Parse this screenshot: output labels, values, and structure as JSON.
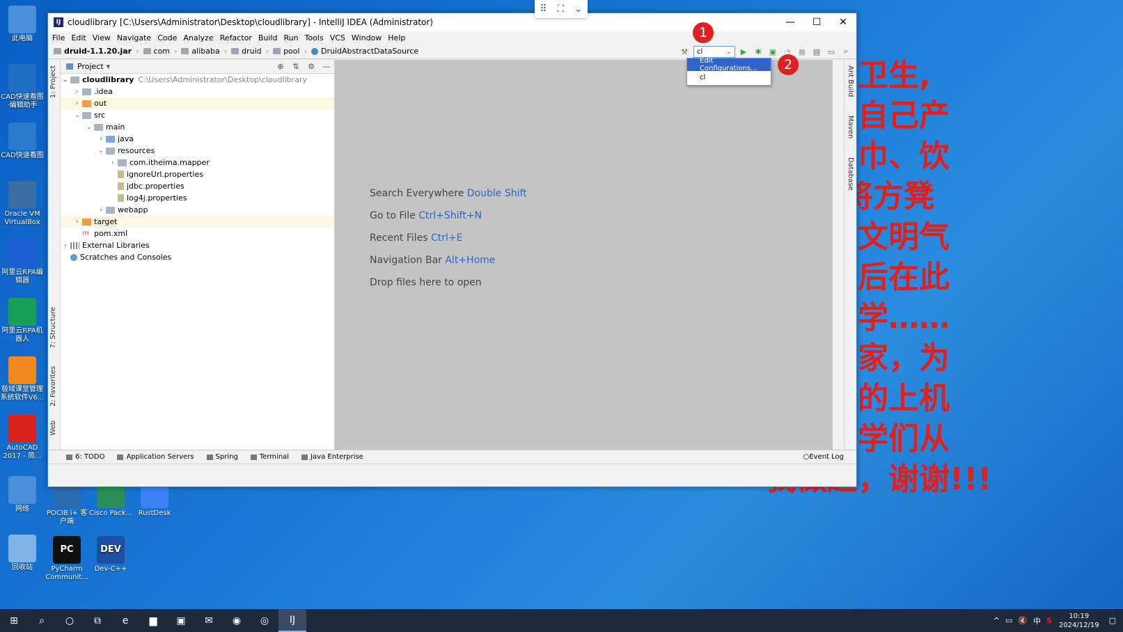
{
  "desktop": {
    "icons": [
      {
        "label": "此电脑",
        "icon": "computer-icon",
        "color": "#4a90d9"
      },
      {
        "label": "CAD快速看图·编辑助手",
        "icon": "cad-icon",
        "color": "#1f6fc5"
      },
      {
        "label": "CAD快速看图",
        "icon": "cad-viewer-icon",
        "color": "#2a7ad0"
      },
      {
        "label": "Oracle VM VirtualBox",
        "icon": "virtualbox-icon",
        "color": "#3b6ea5"
      },
      {
        "label": "阿里云RPA编辑器",
        "icon": "rpa-studio-icon",
        "color": "#1e5fd6"
      },
      {
        "label": "阿里云RPA机器人",
        "icon": "rpa-robot-icon",
        "color": "#18a058"
      },
      {
        "label": "极域课堂管理系统软件V6...",
        "icon": "classroom-icon",
        "color": "#f08a1c"
      },
      {
        "label": "AutoCAD 2017 - 简...",
        "icon": "autocad-icon",
        "color": "#d9231f"
      },
      {
        "label": "网络",
        "icon": "network-icon",
        "color": "#4a90d9"
      },
      {
        "label": "回收站",
        "icon": "recycle-bin-icon",
        "color": "#7fb3e6"
      }
    ],
    "bottom_icons": [
      {
        "label": "POCIB i+ 客户端",
        "icon": "pocib-icon",
        "color": "#2b6cb0"
      },
      {
        "label": "Cisco Pack...",
        "icon": "cisco-icon",
        "color": "#2a8f5a"
      },
      {
        "label": "RustDesk",
        "icon": "rustdesk-icon",
        "color": "#3b82f6"
      },
      {
        "label": "PyCharm Communit...",
        "icon": "pycharm-icon",
        "color": "#111111",
        "glyph": "PC"
      },
      {
        "label": "Dev-C++",
        "icon": "devcpp-icon",
        "color": "#1e4fa0",
        "glyph": "DEV"
      }
    ],
    "red_notice": [
      "房清洁卫生,",
      "行清理自己产",
      "圾（纸巾、饮",
      "），并将方凳",
      "把你的文明气",
      "导给随后在此",
      "课的同学……",
      "生靠大家，为",
      "们自己的上机",
      "麻烦同学们从",
      "我做起，谢谢!!!"
    ],
    "red_color": "#e0201c"
  },
  "remote_bar": {
    "icons": [
      "grid-icon",
      "fullscreen-icon",
      "chevron-down-icon"
    ]
  },
  "window": {
    "title": "cloudlibrary [C:\\Users\\Administrator\\Desktop\\cloudlibrary] - IntelliJ IDEA (Administrator)",
    "menu": [
      "File",
      "Edit",
      "View",
      "Navigate",
      "Code",
      "Analyze",
      "Refactor",
      "Build",
      "Run",
      "Tools",
      "VCS",
      "Window",
      "Help"
    ],
    "breadcrumb": [
      "druid-1.1.20.jar",
      "com",
      "alibaba",
      "druid",
      "pool",
      "DruidAbstractDataSource"
    ],
    "run_config": "cl",
    "dropdown": {
      "items": [
        "Edit Configurations...",
        "cl"
      ]
    },
    "badges": [
      "1",
      "2"
    ],
    "badge_color": "#e02020",
    "project": {
      "header": "Project",
      "root_name": "cloudlibrary",
      "root_path": "C:\\Users\\Administrator\\Desktop\\cloudlibrary",
      "tree": [
        {
          "label": ".idea",
          "depth": 1,
          "arrow": "›",
          "icon": "folder"
        },
        {
          "label": "out",
          "depth": 1,
          "arrow": "›",
          "icon": "folder-o",
          "hl": true
        },
        {
          "label": "src",
          "depth": 1,
          "arrow": "⌄",
          "icon": "folder"
        },
        {
          "label": "main",
          "depth": 2,
          "arrow": "⌄",
          "icon": "folder"
        },
        {
          "label": "java",
          "depth": 3,
          "arrow": "›",
          "icon": "folder-b"
        },
        {
          "label": "resources",
          "depth": 3,
          "arrow": "⌄",
          "icon": "folder"
        },
        {
          "label": "com.itheima.mapper",
          "depth": 4,
          "arrow": "›",
          "icon": "folder"
        },
        {
          "label": "ignoreUrl.properties",
          "depth": 4,
          "arrow": "",
          "icon": "prop"
        },
        {
          "label": "jdbc.properties",
          "depth": 4,
          "arrow": "",
          "icon": "prop"
        },
        {
          "label": "log4j.properties",
          "depth": 4,
          "arrow": "",
          "icon": "prop"
        },
        {
          "label": "webapp",
          "depth": 3,
          "arrow": "›",
          "icon": "folder"
        },
        {
          "label": "target",
          "depth": 1,
          "arrow": "›",
          "icon": "folder-o",
          "hl": true
        },
        {
          "label": "pom.xml",
          "depth": 1,
          "arrow": "",
          "icon": "xml"
        },
        {
          "label": "External Libraries",
          "depth": 0,
          "arrow": "›",
          "icon": "lib"
        },
        {
          "label": "Scratches and Consoles",
          "depth": 0,
          "arrow": "",
          "icon": "scratch"
        }
      ]
    },
    "left_tabs": [
      "1: Project",
      "7: Structure",
      "2: Favorites",
      "Web"
    ],
    "right_tabs": [
      "Ant Build",
      "Maven",
      "Database"
    ],
    "editor_hints": [
      {
        "text": "Search Everywhere",
        "key": "Double Shift"
      },
      {
        "text": "Go to File",
        "key": "Ctrl+Shift+N"
      },
      {
        "text": "Recent Files",
        "key": "Ctrl+E"
      },
      {
        "text": "Navigation Bar",
        "key": "Alt+Home"
      },
      {
        "text": "Drop files here to open",
        "key": ""
      }
    ],
    "bottom_tabs": [
      "6: TODO",
      "Application Servers",
      "Spring",
      "Terminal",
      "Java Enterprise"
    ],
    "event_log": "Event Log"
  },
  "taskbar": {
    "clock_time": "10:19",
    "clock_date": "2024/12/19",
    "ime": "中",
    "apps": [
      "start-icon",
      "search-icon",
      "cortana-icon",
      "task-view-icon",
      "edge-icon",
      "explorer-icon",
      "store-icon",
      "mail-icon",
      "chrome-icon",
      "app-icon",
      "intellij-icon"
    ]
  }
}
